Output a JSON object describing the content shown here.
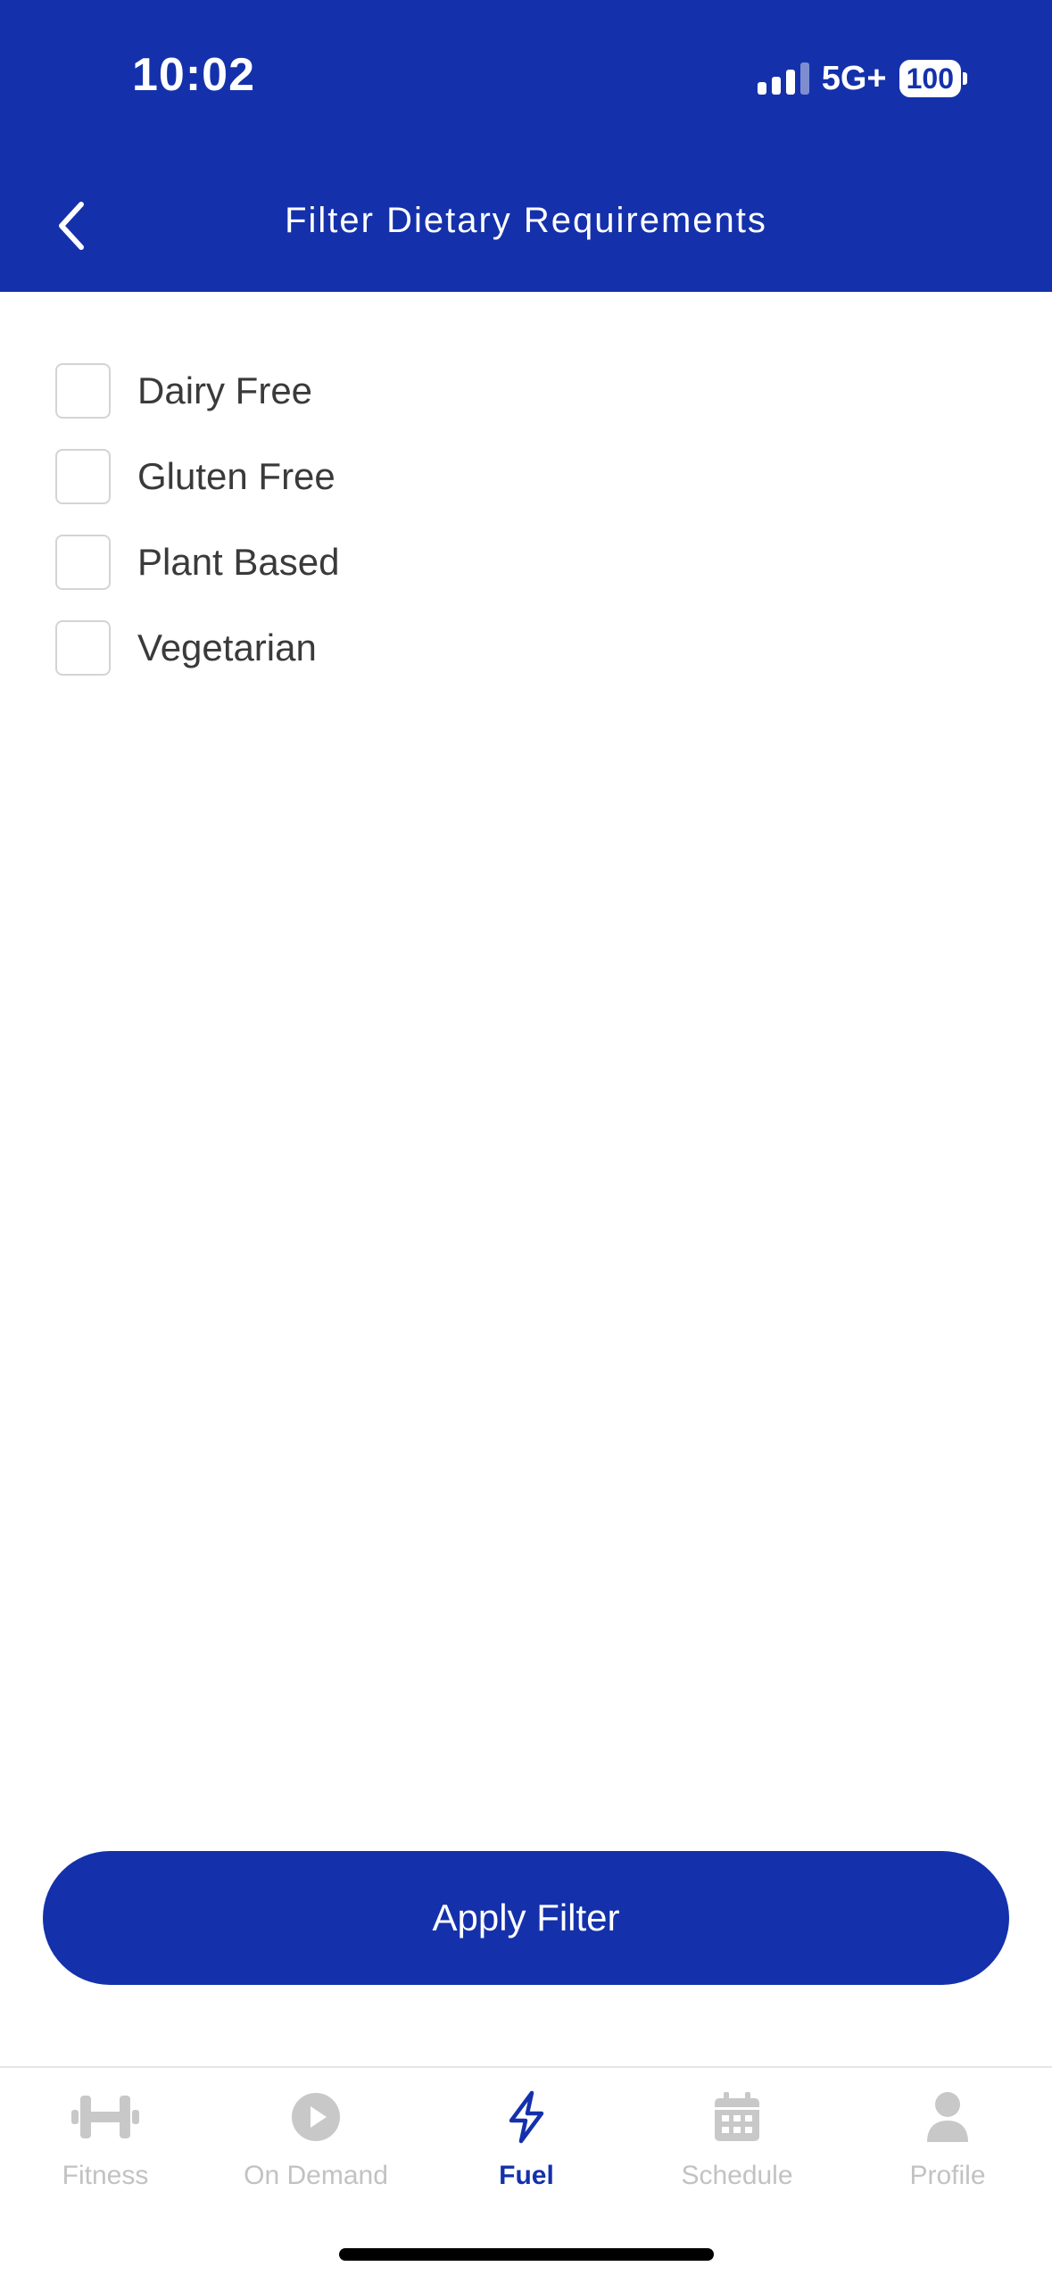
{
  "status_bar": {
    "time": "10:02",
    "network": "5G+",
    "battery": "100"
  },
  "header": {
    "title": "Filter Dietary Requirements",
    "back_icon": "chevron-left-icon",
    "background_color": "#1431ab"
  },
  "filters": [
    {
      "label": "Dairy Free",
      "checked": false
    },
    {
      "label": "Gluten Free",
      "checked": false
    },
    {
      "label": "Plant Based",
      "checked": false
    },
    {
      "label": "Vegetarian",
      "checked": false
    }
  ],
  "apply_button": {
    "label": "Apply Filter"
  },
  "tabbar": {
    "tabs": [
      {
        "label": "Fitness",
        "icon": "dumbbell-icon",
        "active": false
      },
      {
        "label": "On Demand",
        "icon": "play-icon",
        "active": false
      },
      {
        "label": "Fuel",
        "icon": "lightning-icon",
        "active": true
      },
      {
        "label": "Schedule",
        "icon": "calendar-icon",
        "active": false
      },
      {
        "label": "Profile",
        "icon": "person-icon",
        "active": false
      }
    ],
    "active_color": "#1431ab",
    "inactive_color": "#c2c2c2"
  }
}
